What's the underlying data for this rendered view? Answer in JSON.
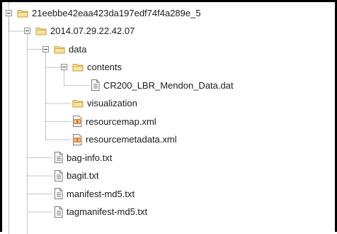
{
  "tree": [
    {
      "id": "root",
      "label": "21eebbe42eaa423da197edf74f4a289e_5",
      "depth": 0,
      "type": "folder",
      "expanded": true
    },
    {
      "id": "date",
      "label": "2014.07.29.22.42.07",
      "depth": 1,
      "type": "folder",
      "expanded": true
    },
    {
      "id": "data",
      "label": "data",
      "depth": 2,
      "type": "folder",
      "expanded": true
    },
    {
      "id": "contents",
      "label": "contents",
      "depth": 3,
      "type": "folder",
      "expanded": true
    },
    {
      "id": "datfile",
      "label": "CR200_LBR_Mendon_Data.dat",
      "depth": 4,
      "type": "file"
    },
    {
      "id": "visualization",
      "label": "visualization",
      "depth": 3,
      "type": "folder"
    },
    {
      "id": "resourcemap",
      "label": "resourcemap.xml",
      "depth": 3,
      "type": "xml"
    },
    {
      "id": "resourcemetadata",
      "label": "resourcemetadata.xml",
      "depth": 3,
      "type": "xml"
    },
    {
      "id": "baginfo",
      "label": "bag-info.txt",
      "depth": 2,
      "type": "file"
    },
    {
      "id": "bagit",
      "label": "bagit.txt",
      "depth": 2,
      "type": "file"
    },
    {
      "id": "manifest",
      "label": "manifest-md5.txt",
      "depth": 2,
      "type": "file"
    },
    {
      "id": "tagmanifest",
      "label": "tagmanifest-md5.txt",
      "depth": 2,
      "type": "file"
    }
  ],
  "colors": {
    "folder_fill": "#f9e2a0",
    "folder_stroke": "#c59d32",
    "line": "#8c8c8c",
    "xml_accent": "#e07a1f"
  }
}
